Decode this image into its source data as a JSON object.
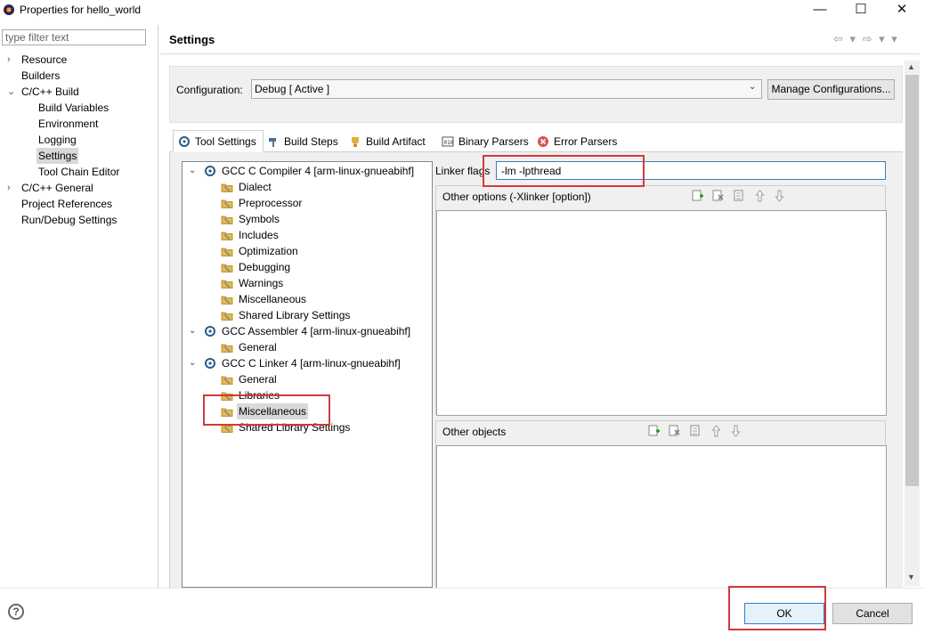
{
  "window": {
    "title": "Properties for hello_world",
    "minimize": "—",
    "maximize": "☐",
    "close": "✕"
  },
  "filter": {
    "placeholder": "type filter text"
  },
  "nav": {
    "items": [
      {
        "label": "Resource",
        "twisty": "›"
      },
      {
        "label": "Builders"
      },
      {
        "label": "C/C++ Build",
        "twisty": "⌄"
      },
      {
        "label": "Build Variables"
      },
      {
        "label": "Environment"
      },
      {
        "label": "Logging"
      },
      {
        "label": "Settings"
      },
      {
        "label": "Tool Chain Editor"
      },
      {
        "label": "C/C++ General",
        "twisty": "›"
      },
      {
        "label": "Project References"
      },
      {
        "label": "Run/Debug Settings"
      }
    ]
  },
  "header": {
    "title": "Settings",
    "nav_arrows": "⇦ ▾ ⇨ ▾ ▾"
  },
  "config": {
    "label": "Configuration:",
    "value": "Debug  [ Active ]",
    "manage_label": "Manage Configurations..."
  },
  "tabs": [
    "Tool Settings",
    "Build Steps",
    "Build Artifact",
    "Binary Parsers",
    "Error Parsers"
  ],
  "tree": {
    "compiler": {
      "label": "GCC C Compiler 4 [arm-linux-gnueabihf]",
      "children": [
        "Dialect",
        "Preprocessor",
        "Symbols",
        "Includes",
        "Optimization",
        "Debugging",
        "Warnings",
        "Miscellaneous",
        "Shared Library Settings"
      ]
    },
    "assembler": {
      "label": "GCC Assembler 4 [arm-linux-gnueabihf]",
      "children": [
        "General"
      ]
    },
    "linker": {
      "label": "GCC C Linker 4 [arm-linux-gnueabihf]",
      "children": [
        "General",
        "Libraries",
        "Miscellaneous",
        "Shared Library Settings"
      ]
    }
  },
  "linker_flags": {
    "label": "Linker flags",
    "value": "-lm -lpthread"
  },
  "other_options": {
    "title": "Other options (-Xlinker [option])"
  },
  "other_objects": {
    "title": "Other objects"
  },
  "buttons": {
    "ok": "OK",
    "cancel": "Cancel",
    "help": "?"
  },
  "colors": {
    "highlight": "#d23a3a",
    "selection": "#d9d9d9",
    "folder": "#e8b84a"
  }
}
